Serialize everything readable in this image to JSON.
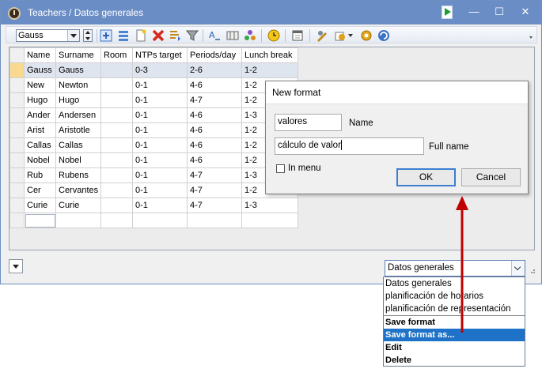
{
  "window": {
    "title": "Teachers / Datos generales"
  },
  "toolbar": {
    "combo_value": "Gauss"
  },
  "grid": {
    "columns": [
      "Name",
      "Surname",
      "Room",
      "NTPs target",
      "Periods/day",
      "Lunch break"
    ],
    "rows": [
      [
        "Gauss",
        "Gauss",
        "",
        "0-3",
        "2-6",
        "1-2"
      ],
      [
        "New",
        "Newton",
        "",
        "0-1",
        "4-6",
        "1-2"
      ],
      [
        "Hugo",
        "Hugo",
        "",
        "0-1",
        "4-7",
        "1-2"
      ],
      [
        "Ander",
        "Andersen",
        "",
        "0-1",
        "4-6",
        "1-3"
      ],
      [
        "Arist",
        "Aristotle",
        "",
        "0-1",
        "4-6",
        "1-2"
      ],
      [
        "Callas",
        "Callas",
        "",
        "0-1",
        "4-6",
        "1-2"
      ],
      [
        "Nobel",
        "Nobel",
        "",
        "0-1",
        "4-6",
        "1-2"
      ],
      [
        "Rub",
        "Rubens",
        "",
        "0-1",
        "4-7",
        "1-3"
      ],
      [
        "Cer",
        "Cervantes",
        "",
        "0-1",
        "4-7",
        "1-2"
      ],
      [
        "Curie",
        "Curie",
        "",
        "0-1",
        "4-7",
        "1-3"
      ],
      [
        "",
        "",
        "",
        "",
        "",
        ""
      ]
    ]
  },
  "format_combo": {
    "value": "Datos generales"
  },
  "format_menu": {
    "formats": [
      "Datos generales",
      "planificación de horarios",
      "planificación de representación"
    ],
    "actions": [
      "Save format",
      "Save format as...",
      "Edit",
      "Delete"
    ],
    "highlighted_action": "Save format as..."
  },
  "dialog": {
    "title": "New format",
    "name_value": "valores",
    "name_label": "Name",
    "fullname_value": "cálculo de valor",
    "fullname_label": "Full name",
    "in_menu_label": "In menu",
    "ok_label": "OK",
    "cancel_label": "Cancel"
  },
  "colors": {
    "titlebar": "#6b8dc6",
    "highlight": "#1e72c7",
    "annotation_arrow": "#c00000"
  }
}
